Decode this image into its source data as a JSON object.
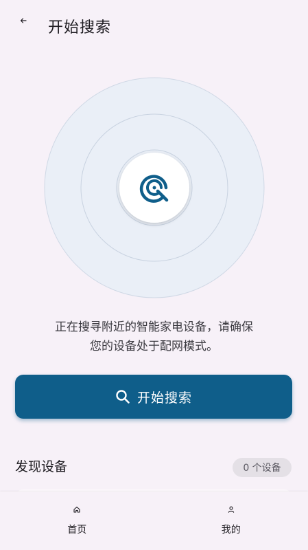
{
  "header": {
    "back_icon": "arrow-left-icon",
    "title": "开始搜索"
  },
  "radar": {
    "center_icon": "wifi-scan-icon",
    "accent": "#0f5e8a",
    "ring_color": "#c7d2e0",
    "fill_color": "#e9eef6"
  },
  "hint": {
    "line1": "正在搜寻附近的智能家电设备，请确保",
    "line2": "您的设备处于配网模式。"
  },
  "search_button": {
    "icon": "search-icon",
    "label": "开始搜索",
    "color": "#0f5e8a"
  },
  "devices": {
    "section_title": "发现设备",
    "count_label": "0 个设备"
  },
  "bottom_nav": {
    "items": [
      {
        "label": "首页",
        "icon": "home-icon"
      },
      {
        "label": "我的",
        "icon": "person-icon"
      }
    ]
  }
}
